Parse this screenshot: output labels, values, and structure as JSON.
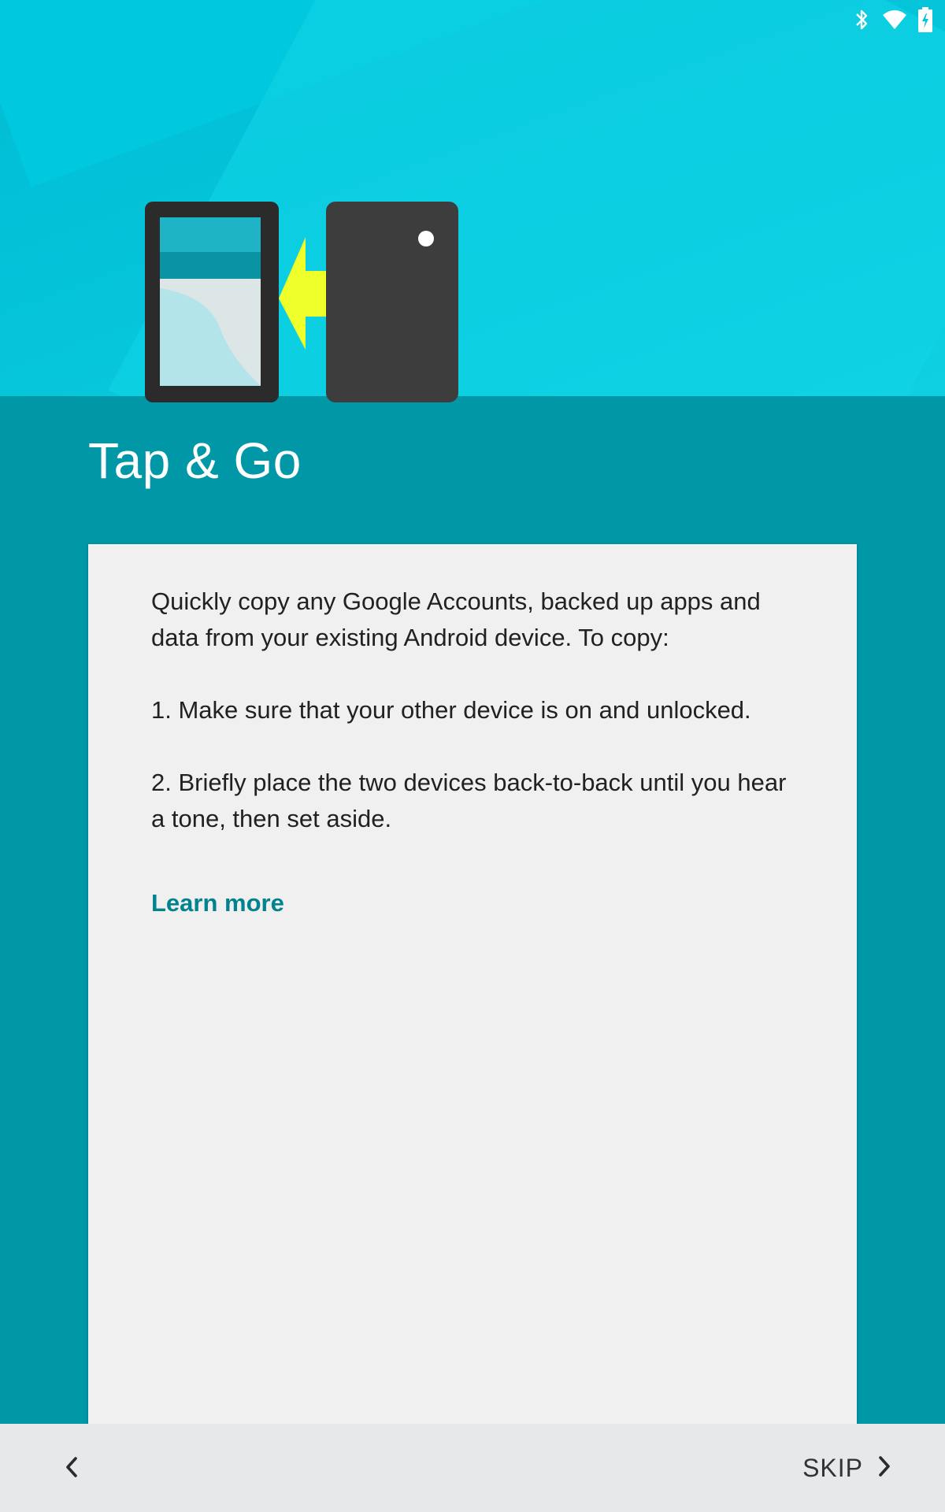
{
  "status_bar": {
    "icons": [
      "bluetooth-icon",
      "wifi-icon",
      "battery-charging-icon"
    ]
  },
  "illustration": {
    "icons": [
      "tablet-device",
      "arrow-left",
      "phone-device"
    ],
    "colors": {
      "device_dark": "#3d3d3d",
      "arrow": "#eeff2a",
      "screen_top": "#1fb3c6"
    }
  },
  "header": {
    "title": "Tap & Go"
  },
  "card": {
    "intro": "Quickly copy any Google Accounts, backed up apps and data from your existing Android device. To copy:",
    "step1": "1. Make sure that your other device is on and unlocked.",
    "step2": "2. Briefly place the two devices back-to-back until you hear a tone, then set aside.",
    "learn_more": "Learn more"
  },
  "bottom_nav": {
    "back_icon": "chevron-left-icon",
    "skip_label": "SKIP",
    "skip_icon": "chevron-right-icon"
  },
  "colors": {
    "hero": "#00c5db",
    "background": "#0097a7",
    "card": "#f0f0f0",
    "link": "#00838f",
    "nav": "#e6e8ea"
  }
}
